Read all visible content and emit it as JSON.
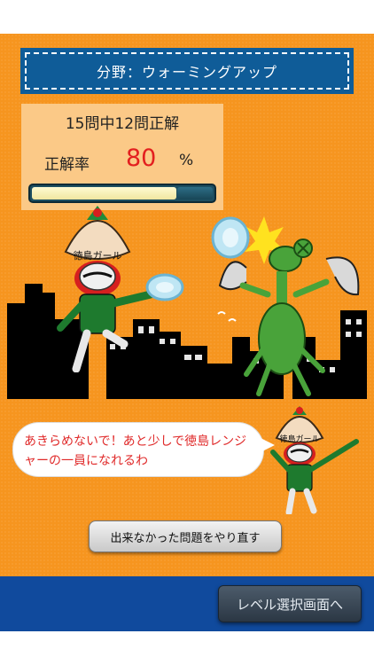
{
  "header": {
    "field_label": "分野：ウォーミングアップ"
  },
  "score": {
    "summary": "15問中12問正解",
    "rate_label": "正解率",
    "rate_value": "80",
    "rate_unit": "%",
    "progress_fraction": 0.8
  },
  "characters": {
    "girl_hat_label": "徳島ガール",
    "small_girl_hat_label": "徳島ガール"
  },
  "speech": {
    "text": "あきらめないで！あと少しで徳島レンジャーの一員になれるわ"
  },
  "buttons": {
    "retry_label": "出来なかった問題をやり直す",
    "level_select_label": "レベル選択画面へ"
  },
  "colors": {
    "background_orange": "#f6951f",
    "banner_blue": "#0f5c98",
    "footer_blue": "#104a9d",
    "rate_red": "#e31f1f",
    "mantis_green": "#49a33a"
  }
}
